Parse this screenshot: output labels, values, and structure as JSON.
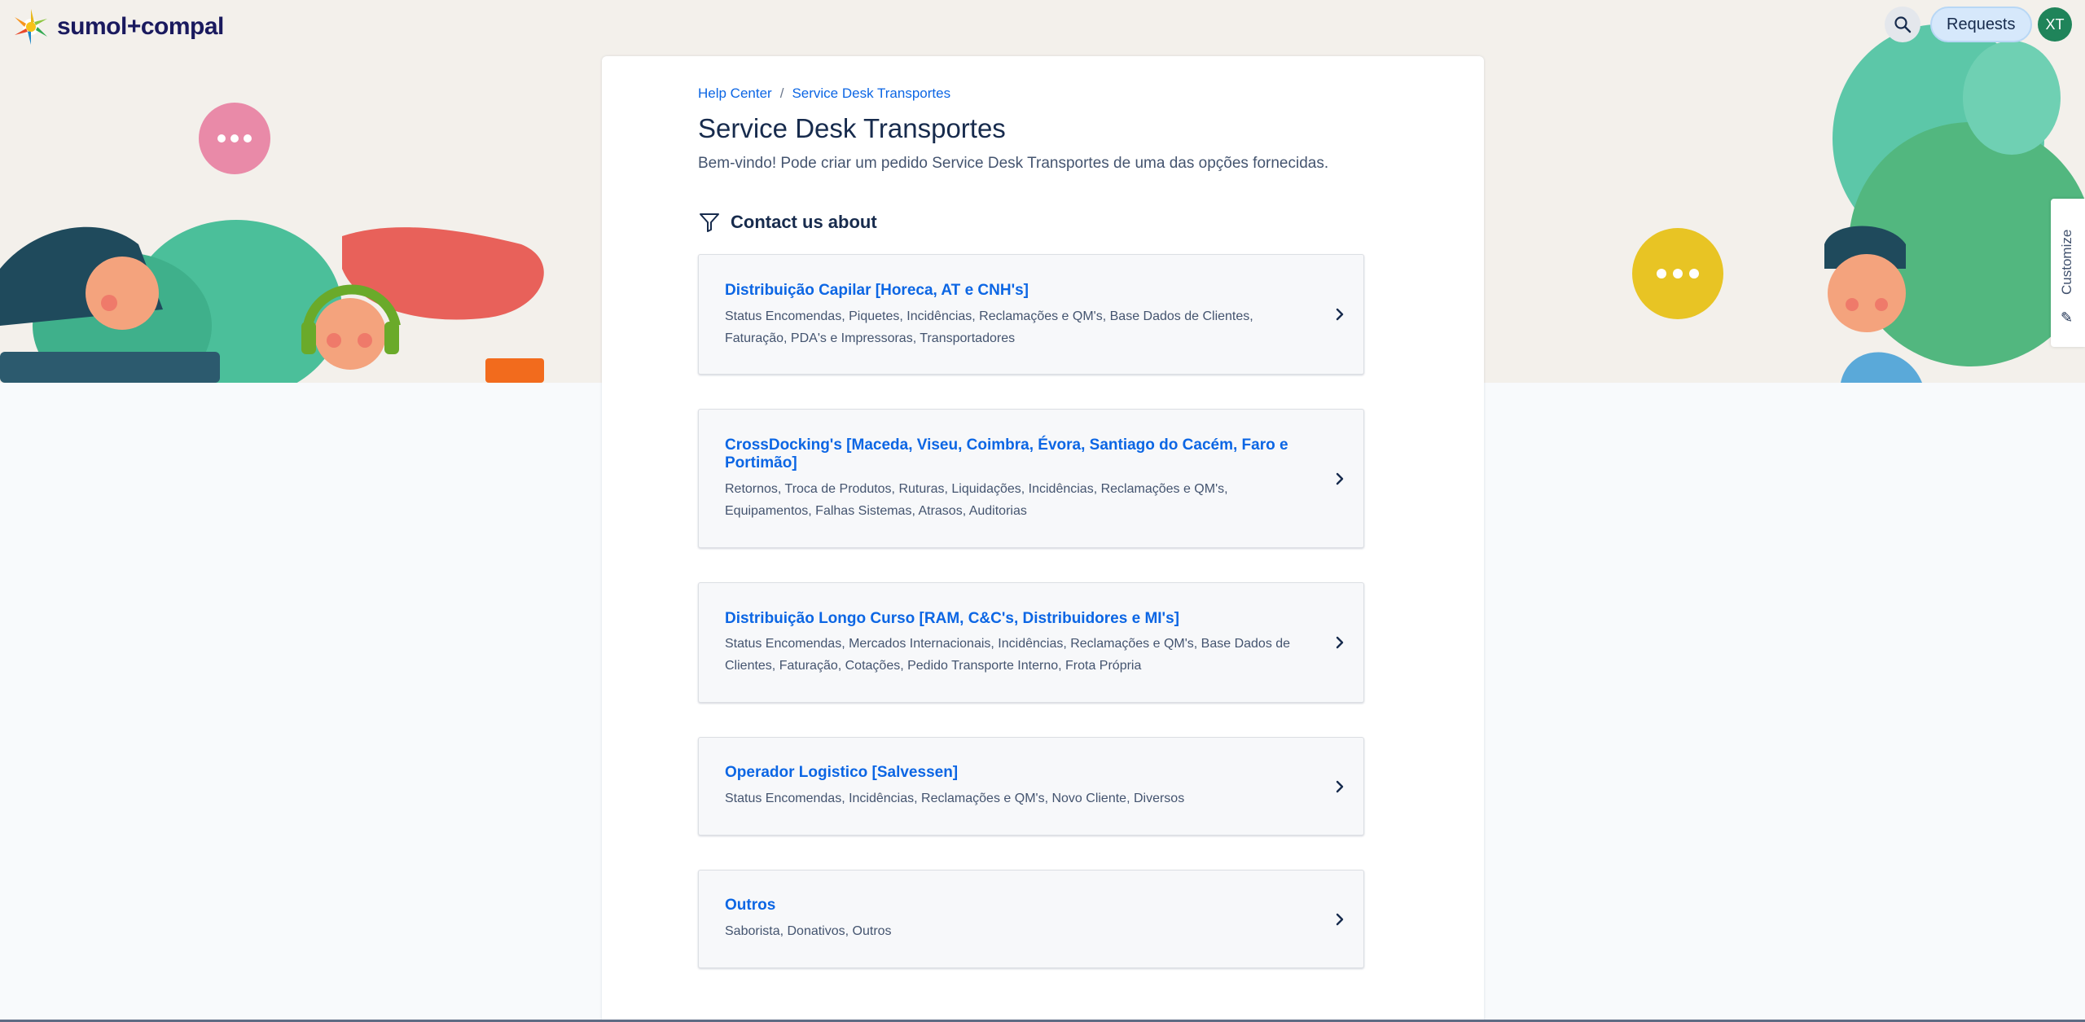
{
  "brand": {
    "name": "sumol+compal"
  },
  "header": {
    "requests_label": "Requests",
    "avatar_initials": "XT",
    "customize_label": "Customize"
  },
  "breadcrumb": [
    "Help Center",
    "Service Desk Transportes"
  ],
  "page": {
    "title": "Service Desk Transportes",
    "description": "Bem-vindo! Pode criar um pedido Service Desk Transportes de uma das opções fornecidas."
  },
  "contact": {
    "heading": "Contact us about",
    "options": [
      {
        "title": "Distribuição Capilar [Horeca, AT e CNH's]",
        "line1": "Status Encomendas, Piquetes, Incidências, Reclamações e QM's, Base Dados de Clientes,",
        "line2": "Faturação, PDA's e Impressoras, Transportadores"
      },
      {
        "title1": "CrossDocking's [Maceda, Viseu, Coimbra, Évora, Santiago do Cacém, Faro e",
        "title2": "Portimão]",
        "line1": "Retornos, Troca de Produtos, Ruturas, Liquidações, Incidências, Reclamações e QM's,",
        "line2": "Equipamentos, Falhas Sistemas, Atrasos, Auditorias"
      },
      {
        "title": "Distribuição Longo Curso [RAM, C&C's, Distribuidores e MI's]",
        "line1": "Status Encomendas, Mercados Internacionais, Incidências, Reclamações e QM's, Base Dados de",
        "line2": "Clientes, Faturação, Cotações, Pedido Transporte Interno, Frota Própria"
      },
      {
        "title": "Operador Logistico [Salvessen]",
        "line1": "Status Encomendas, Incidências, Reclamações e QM's, Novo Cliente, Diversos"
      },
      {
        "title": "Outros",
        "line1": "Saborista, Donativos, Outros"
      }
    ]
  },
  "colors": {
    "link": "#0c66e4",
    "avatar": "#1f845a",
    "requests_bg": "#d6e8fb"
  },
  "icons": [
    "search-icon",
    "filter-icon",
    "chevron-right-icon",
    "pencil-icon"
  ]
}
